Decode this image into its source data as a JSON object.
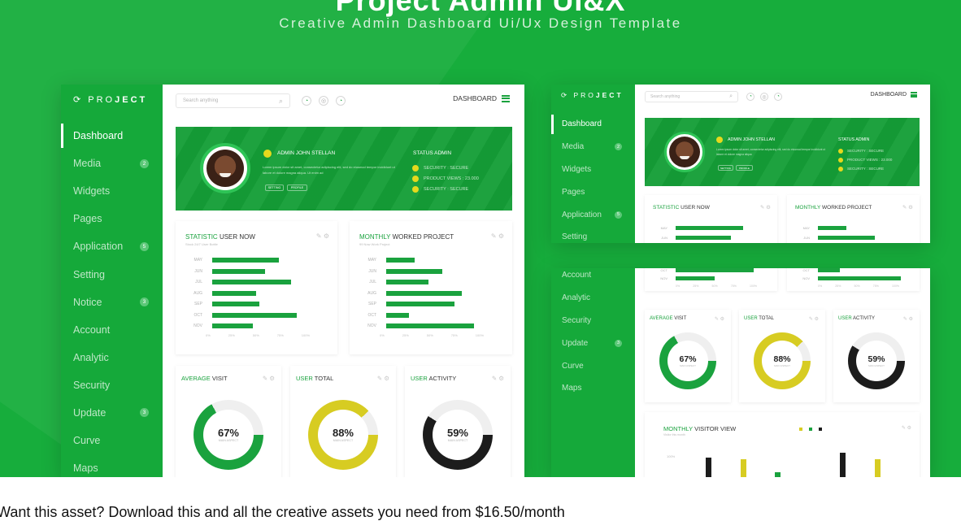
{
  "hero": {
    "title": "Project Admin UI&X",
    "subtitle": "Creative Admin Dashboard Ui/Ux Design Template"
  },
  "colors": {
    "brand_green": "#17ad3c",
    "accent_yellow": "#d7cc22",
    "dark": "#1c1c1c"
  },
  "logo": {
    "light": "PRO",
    "bold": "JECT"
  },
  "search": {
    "placeholder": "Search anything"
  },
  "topbar": {
    "dashboard_label": "DASHBOARD"
  },
  "sidebar": {
    "items": [
      {
        "label": "Dashboard",
        "badge": ""
      },
      {
        "label": "Media",
        "badge": "2"
      },
      {
        "label": "Widgets",
        "badge": ""
      },
      {
        "label": "Pages",
        "badge": ""
      },
      {
        "label": "Application",
        "badge": "5"
      },
      {
        "label": "Setting",
        "badge": ""
      },
      {
        "label": "Notice",
        "badge": "3"
      },
      {
        "label": "Account",
        "badge": ""
      },
      {
        "label": "Analytic",
        "badge": ""
      },
      {
        "label": "Security",
        "badge": ""
      },
      {
        "label": "Update",
        "badge": "3"
      },
      {
        "label": "Curve",
        "badge": ""
      },
      {
        "label": "Maps",
        "badge": ""
      }
    ]
  },
  "profile": {
    "name": "ADMIN JOHN STELLAN",
    "buttons": [
      "SETTING",
      "PROFILE"
    ],
    "status_title": "STATUS ADMIN",
    "status_items": [
      "SECURITY : SECURE",
      "PRODUCT VIEWS : 23.000",
      "SECURITY : SECURE"
    ]
  },
  "statistic_card": {
    "title_green": "STATISTIC",
    "title_dark": "USER NOW",
    "months": [
      "MAY",
      "JUN",
      "JUL",
      "AUG",
      "SEP",
      "OCT",
      "NOV"
    ],
    "values": [
      73,
      58,
      87,
      48,
      52,
      93,
      45
    ],
    "ticks": [
      "0%",
      "25%",
      "50%",
      "75%",
      "100%"
    ]
  },
  "monthly_card": {
    "title_green": "MONTHLY",
    "title_dark": "WORKED PROJECT",
    "months": [
      "MAY",
      "JUN",
      "JUL",
      "AUG",
      "SEP",
      "OCT",
      "NOV"
    ],
    "values": [
      31,
      62,
      46,
      83,
      75,
      25,
      96
    ],
    "ticks": [
      "0%",
      "25%",
      "50%",
      "75%",
      "100%"
    ]
  },
  "donuts": [
    {
      "title_green": "AVERAGE",
      "title_dark": "VISIT",
      "value": "67%",
      "percent": 67,
      "color": "#1aa23e",
      "caption": "MAIN ASPECT"
    },
    {
      "title_green": "USER",
      "title_dark": "TOTAL",
      "value": "88%",
      "percent": 88,
      "color": "#d7cc22",
      "caption": "MAIN ASPECT"
    },
    {
      "title_green": "USER",
      "title_dark": "ACTIVITY",
      "value": "59%",
      "percent": 59,
      "color": "#1c1c1c",
      "caption": "MAIN ASPECT"
    }
  ],
  "visitor_card": {
    "title_green": "MONTHLY",
    "title_dark": "VISITOR VIEW",
    "ytick": "100%",
    "bars": [
      {
        "value": 60,
        "color": "#1c1c1c"
      },
      {
        "value": 55,
        "color": "#d7cc22"
      },
      {
        "value": 15,
        "color": "#1aa23e"
      },
      {
        "value": 75,
        "color": "#1c1c1c"
      },
      {
        "value": 55,
        "color": "#d7cc22"
      }
    ]
  },
  "footer": {
    "cta": "Want this asset? Download this and all the creative assets you need from $16.50/month"
  }
}
